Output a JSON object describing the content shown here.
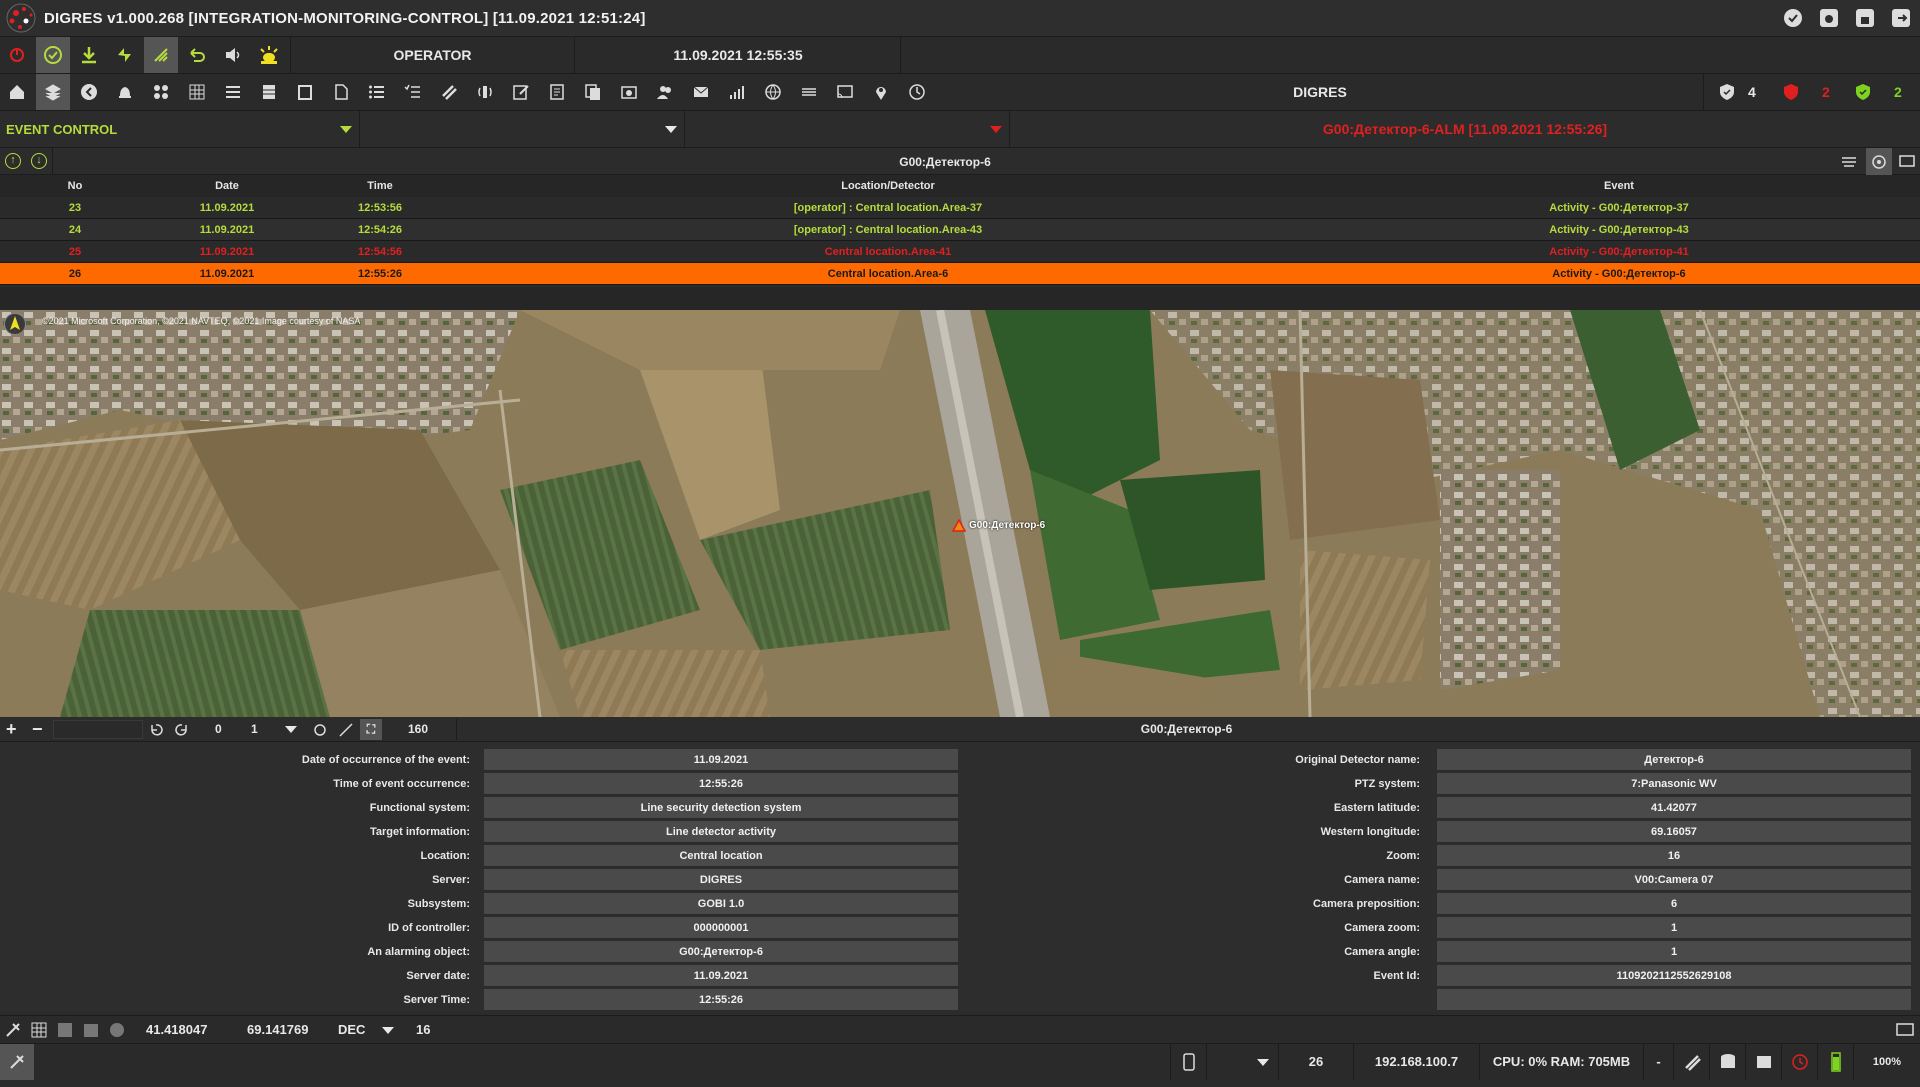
{
  "window": {
    "title": "DIGRES v1.000.268 [INTEGRATION-MONITORING-CONTROL] [11.09.2021 12:51:24]"
  },
  "toolbar": {
    "operator_label": "OPERATOR",
    "datetime": "11.09.2021 12:55:35",
    "system_label": "DIGRES",
    "counters": [
      {
        "name": "shield",
        "value": "4",
        "color": "#e8e8e8"
      },
      {
        "name": "alarm-shield",
        "value": "2",
        "color": "#e02020"
      },
      {
        "name": "ok-shield",
        "value": "2",
        "color": "#7ed321"
      }
    ]
  },
  "event_control": {
    "label": "EVENT CONTROL",
    "filter2": "",
    "filter3": "",
    "alarm_banner": "G00:Детектор-6-ALM [11.09.2021 12:55:26]"
  },
  "events_panel": {
    "title": "G00:Детектор-6",
    "columns": {
      "no": "No",
      "date": "Date",
      "time": "Time",
      "location": "Location/Detector",
      "event": "Event"
    },
    "rows": [
      {
        "no": "23",
        "date": "11.09.2021",
        "time": "12:53:56",
        "location": "[operator] : Central location.Area-37",
        "event": "Activity - G00:Детектор-37",
        "status": "ack"
      },
      {
        "no": "24",
        "date": "11.09.2021",
        "time": "12:54:26",
        "location": "[operator] : Central location.Area-43",
        "event": "Activity - G00:Детектор-43",
        "status": "ack"
      },
      {
        "no": "25",
        "date": "11.09.2021",
        "time": "12:54:56",
        "location": "Central location.Area-41",
        "event": "Activity - G00:Детектор-41",
        "status": "alarm"
      },
      {
        "no": "26",
        "date": "11.09.2021",
        "time": "12:55:26",
        "location": "Central location.Area-6",
        "event": "Activity - G00:Детектор-6",
        "status": "selected"
      }
    ]
  },
  "map": {
    "copyright": "©2021 Microsoft Corporation, ©2021 NAVTEQ, ©2021 Image courtesy of NASA",
    "marker_label": "G00:Детектор-6"
  },
  "map_tools": {
    "rotation": "0",
    "step": "1",
    "scale": "160",
    "title": "G00:Детектор-6"
  },
  "details_left": [
    {
      "label": "Date of occurrence of the event:",
      "value": "11.09.2021"
    },
    {
      "label": "Time of event occurrence:",
      "value": "12:55:26"
    },
    {
      "label": "Functional system:",
      "value": "Line security detection system"
    },
    {
      "label": "Target information:",
      "value": "Line detector activity"
    },
    {
      "label": "Location:",
      "value": "Central location"
    },
    {
      "label": "Server:",
      "value": "DIGRES"
    },
    {
      "label": "Subsystem:",
      "value": "GOBI 1.0"
    },
    {
      "label": "ID of controller:",
      "value": "000000001"
    },
    {
      "label": "An alarming object:",
      "value": "G00:Детектор-6"
    },
    {
      "label": "Server date:",
      "value": "11.09.2021"
    },
    {
      "label": "Server Time:",
      "value": "12:55:26"
    }
  ],
  "details_right": [
    {
      "label": "Original Detector name:",
      "value": "Детектор-6"
    },
    {
      "label": "PTZ system:",
      "value": "7:Panasonic WV"
    },
    {
      "label": "Eastern latitude:",
      "value": "41.42077"
    },
    {
      "label": "Western longitude:",
      "value": "69.16057"
    },
    {
      "label": "Zoom:",
      "value": "16"
    },
    {
      "label": "Camera name:",
      "value": "V00:Camera 07"
    },
    {
      "label": "Camera preposition:",
      "value": "6"
    },
    {
      "label": "Camera zoom:",
      "value": "1"
    },
    {
      "label": "Camera angle:",
      "value": "1"
    },
    {
      "label": "Event Id:",
      "value": "1109202112552629108"
    },
    {
      "label": "",
      "value": ""
    }
  ],
  "coords": {
    "lat": "41.418047",
    "lon": "69.141769",
    "format": "DEC",
    "zoom": "16"
  },
  "status": {
    "count": "26",
    "ip": "192.168.100.7",
    "cpu_ram": "CPU: 0% RAM: 705MB",
    "dash": "-",
    "zoom": "100%"
  },
  "colors": {
    "accent_green": "#b5dc3c",
    "alarm_red": "#e02020",
    "selected_orange": "#ff6a00"
  }
}
